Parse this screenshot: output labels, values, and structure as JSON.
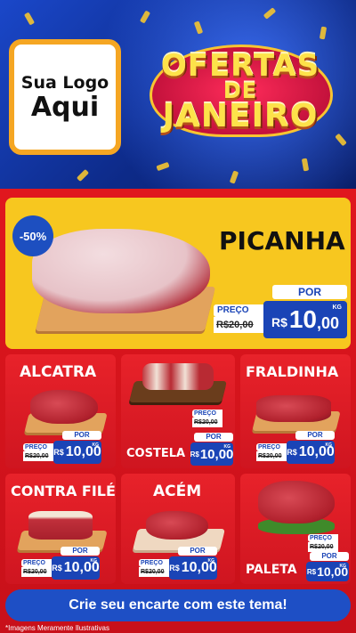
{
  "header": {
    "logo_line1": "Sua Logo",
    "logo_line2": "Aqui",
    "headline_1": "OFERTAS",
    "headline_2": "DE",
    "headline_3": "JANEIRO"
  },
  "featured": {
    "discount": "-50%",
    "name": "PICANHA",
    "por_label": "POR",
    "preco_label": "PREÇO",
    "old_price": "R$20,00",
    "currency": "R$",
    "new_price_int": "10",
    "new_price_dec": ",00",
    "unit": "KG"
  },
  "products": [
    {
      "name": "ALCATRA",
      "preco_label": "PREÇO",
      "por_label": "POR",
      "old_price": "R$20,00",
      "currency": "R$",
      "new_price": "10,00",
      "unit": "KG"
    },
    {
      "name": "COSTELA",
      "preco_label": "PREÇO",
      "por_label": "POR",
      "old_price": "R$20,00",
      "currency": "R$",
      "new_price": "10,00",
      "unit": "KG"
    },
    {
      "name": "FRALDINHA",
      "preco_label": "PREÇO",
      "por_label": "POR",
      "old_price": "R$20,00",
      "currency": "R$",
      "new_price": "10,00",
      "unit": "KG"
    },
    {
      "name": "CONTRA FILÉ",
      "preco_label": "PREÇO",
      "por_label": "POR",
      "old_price": "R$20,00",
      "currency": "R$",
      "new_price": "10,00",
      "unit": "KG"
    },
    {
      "name": "ACÉM",
      "preco_label": "PREÇO",
      "por_label": "POR",
      "old_price": "R$20,00",
      "currency": "R$",
      "new_price": "10,00",
      "unit": "KG"
    },
    {
      "name": "PALETA",
      "preco_label": "PREÇO",
      "por_label": "POR",
      "old_price": "R$20,00",
      "currency": "R$",
      "new_price": "10,00",
      "unit": "KG"
    }
  ],
  "footer": {
    "cta": "Crie seu encarte com este tema!",
    "disclaimer": "*Imagens Meramente Ilustrativas"
  },
  "colors": {
    "header_blue": "#1a47c9",
    "main_red": "#e0171e",
    "featured_yellow": "#f7c71f",
    "price_blue": "#1a44b6"
  }
}
